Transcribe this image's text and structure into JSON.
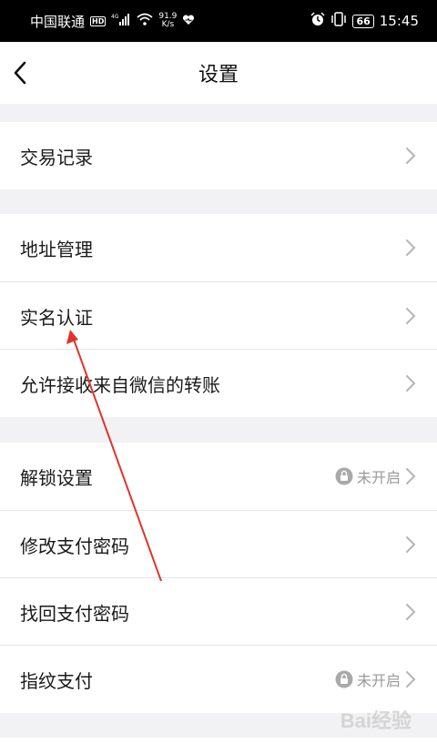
{
  "status_bar": {
    "carrier": "中国联通",
    "hd": "HD",
    "signal_label": "4G",
    "net_speed_value": "91.9",
    "net_speed_unit": "K/s",
    "battery": "66",
    "time": "15:45"
  },
  "nav": {
    "title": "设置"
  },
  "rows": [
    {
      "label": "交易记录",
      "status": ""
    },
    {
      "label": "地址管理",
      "status": ""
    },
    {
      "label": "实名认证",
      "status": ""
    },
    {
      "label": "允许接收来自微信的转账",
      "status": ""
    },
    {
      "label": "解锁设置",
      "status": "未开启"
    },
    {
      "label": "修改支付密码",
      "status": ""
    },
    {
      "label": "找回支付密码",
      "status": ""
    },
    {
      "label": "指纹支付",
      "status": "未开启"
    }
  ],
  "watermark": "Bai经验",
  "colors": {
    "background": "#f2f2f4",
    "row_bg": "#ffffff",
    "chevron": "#b5b5b5",
    "annotation_arrow": "#e0342b"
  }
}
